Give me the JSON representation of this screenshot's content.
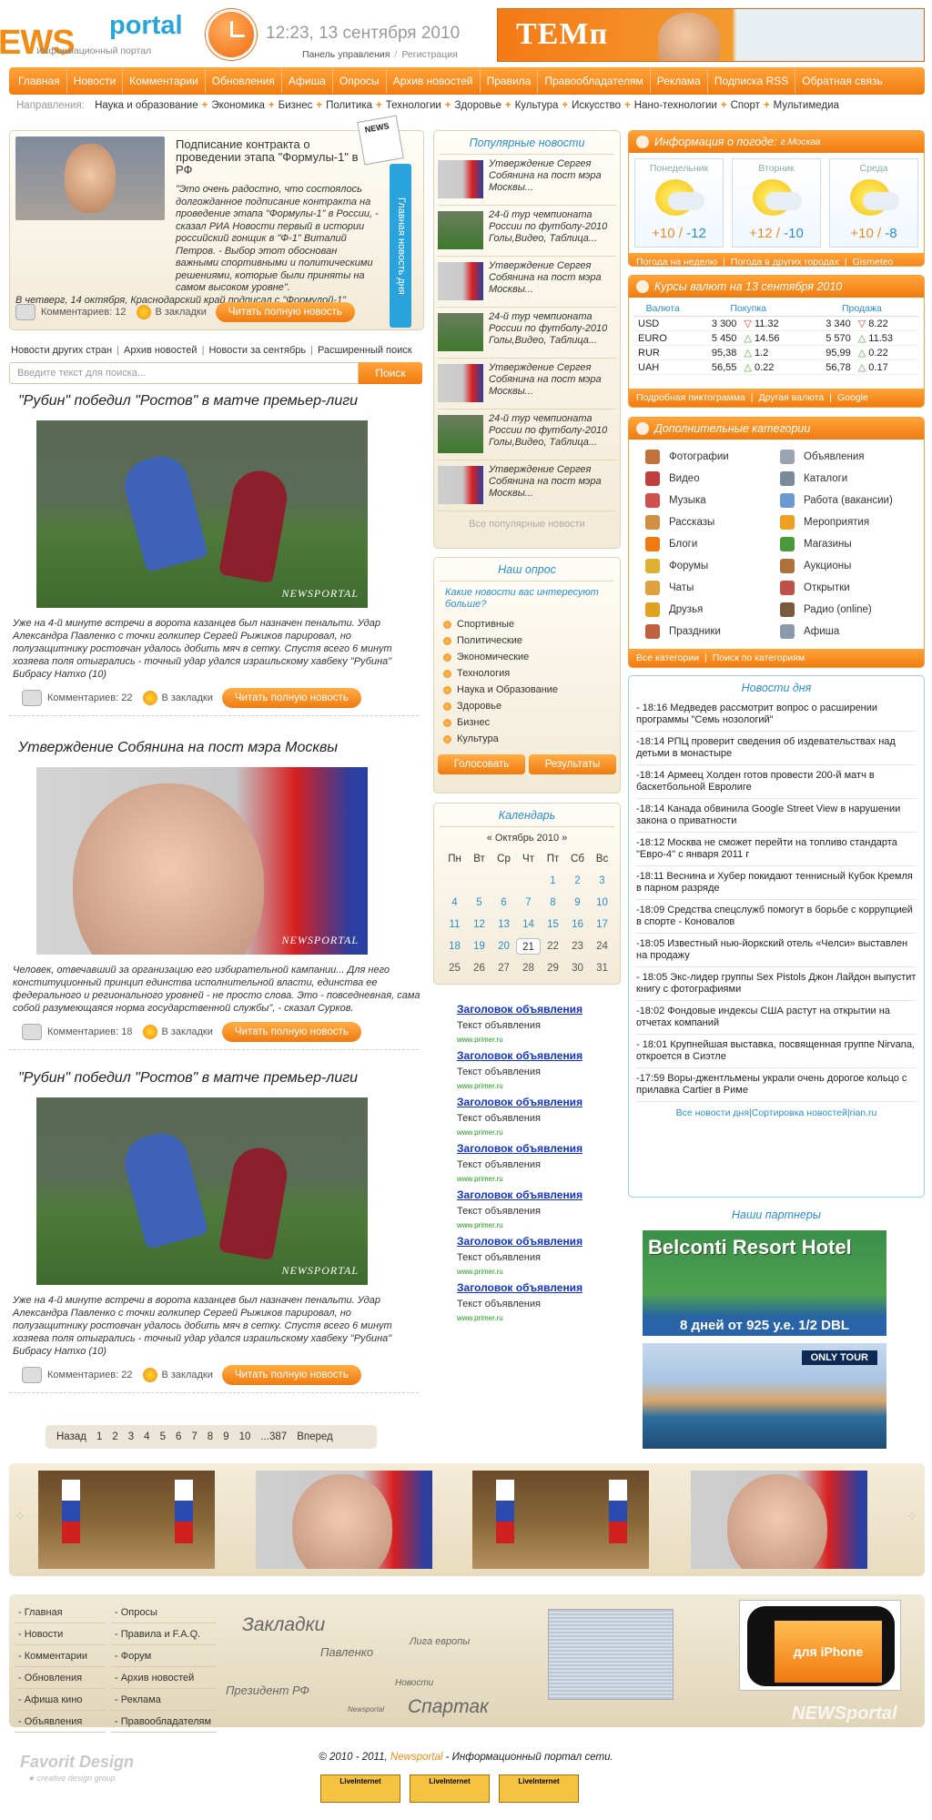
{
  "header": {
    "logo_news": "EWS",
    "logo_portal": "portal",
    "logo_sub": "Информационный портал",
    "datetime": "12:23, 13 сентября 2010",
    "panel_link": "Панель управления",
    "register_link": "Регистрация",
    "banner_text": "ТЕМп"
  },
  "nav": [
    "Главная",
    "Новости",
    "Комментарии",
    "Обновления",
    "Афиша",
    "Опросы",
    "Архив новостей",
    "Правила",
    "Правообладателям",
    "Реклама",
    "Подписка RSS",
    "Обратная связь"
  ],
  "directions": {
    "label": "Направления:",
    "items": [
      "Наука и образование",
      "Экономика",
      "Бизнес",
      "Политика",
      "Технологии",
      "Здоровье",
      "Культура",
      "Искусство",
      "Нано-технологии",
      "Спорт",
      "Мультимедиа"
    ]
  },
  "top_story": {
    "title": "Подписание контракта о проведении этапа \"Формулы-1\" в РФ",
    "paragraph1": "\"Это очень радостно, что состоялось долгожданное подписание контракта на проведение этапа \"Формулы-1\" в России, - сказал РИА Новости первый в истории российский гонщик в \"Ф-1\" Виталий Петров. - Выбор этот обоснован важными спортивными и политическими решениями, которые были приняты на самом высоком уровне\".",
    "paragraph2": "В четверг, 14 октября, Краснодарский край подписал с \"Формулой-1\"",
    "comments": "Комментариев: 12",
    "bookmark": "В закладки",
    "read": "Читать полную новость",
    "tag": "Главная новость дня",
    "paper": "NEWS"
  },
  "subnav": [
    "Новости других стран",
    "Архив новостей",
    "Новости за сентябрь",
    "Расширенный поиск"
  ],
  "search": {
    "placeholder": "Введите текст для поиска...",
    "button": "Поиск"
  },
  "articles": [
    {
      "title": "\"Рубин\" победил \"Ростов\" в матче премьер-лиги",
      "watermark": "NEWSPORTAL",
      "text": "Уже на 4-й минуте встречи в ворота казанцев был назначен пенальти. Удар Александра Павленко с точки голкипер Сергей Рыжиков парировал, но полузащитнику ростовчан удалось добить мяч в сетку. Спустя всего 6 минут хозяева поля отыгрались - точный удар удался израильскому хавбеку \"Рубина\" Бибрасу Натхо (10)",
      "comments": "Комментариев: 22",
      "bookmark": "В закладки",
      "read": "Читать полную новость"
    },
    {
      "title": "Утверждение Собянина на пост мэра Москвы",
      "watermark": "NEWSPORTAL",
      "text": "Человек, отвечавший за организацию его избирательной кампании... Для него конституционный принцип единства исполнительной власти, единства ее федерального и регионального уровней - не просто слова. Это - повседневная, сама собой разумеющаяся норма государственной службы\", - сказал Сурков.",
      "comments": "Комментариев: 18",
      "bookmark": "В закладки",
      "read": "Читать полную новость"
    },
    {
      "title": "\"Рубин\" победил \"Ростов\" в матче премьер-лиги",
      "watermark": "NEWSPORTAL",
      "text": "Уже на 4-й минуте встречи в ворота казанцев был назначен пенальти. Удар Александра Павленко с точки голкипер Сергей Рыжиков парировал, но полузащитнику ростовчан удалось добить мяч в сетку. Спустя всего 6 минут хозяева поля отыгрались - точный удар удался израильскому хавбеку \"Рубина\" Бибрасу Натхо (10)",
      "comments": "Комментариев: 22",
      "bookmark": "В закладки",
      "read": "Читать полную новость"
    }
  ],
  "pager": [
    "Назад",
    "1",
    "2",
    "3",
    "4",
    "5",
    "6",
    "7",
    "8",
    "9",
    "10",
    "...387",
    "Вперед"
  ],
  "popular": {
    "title": "Популярные новости",
    "items": [
      "Утверждение Сергея Собянина на пост мэра Москвы...",
      "24-й тур чемпионата России по футболу-2010 Голы,Видео, Таблица...",
      "Утверждение Сергея Собянина на пост мэра Москвы...",
      "24-й тур чемпионата России по футболу-2010 Голы,Видео, Таблица...",
      "Утверждение Сергея Собянина на пост мэра Москвы...",
      "24-й тур чемпионата России по футболу-2010 Голы,Видео, Таблица...",
      "Утверждение Сергея Собянина на пост мэра Москвы..."
    ],
    "all": "Все популярные новости"
  },
  "poll": {
    "title": "Наш опрос",
    "question": "Какие новости вас интересуют больше?",
    "options": [
      "Спортивные",
      "Политические",
      "Экономические",
      "Технология",
      "Наука и Образование",
      "Здоровье",
      "Бизнес",
      "Культура"
    ],
    "vote": "Голосовать",
    "results": "Результаты"
  },
  "calendar": {
    "title": "Календарь",
    "month": "«   Октябрь 2010   »",
    "days": [
      "Пн",
      "Вт",
      "Ср",
      "Чт",
      "Пт",
      "Сб",
      "Вс"
    ],
    "dates": [
      "1",
      "2",
      "3",
      "4",
      "5",
      "6",
      "7",
      "8",
      "9",
      "10",
      "11",
      "12",
      "13",
      "14",
      "15",
      "16",
      "17",
      "18",
      "19",
      "20",
      "21",
      "22",
      "23",
      "24",
      "25",
      "26",
      "27",
      "28",
      "29",
      "30",
      "31"
    ],
    "today": "21"
  },
  "ads": {
    "title": "Заголовок объявления",
    "text": "Текст объявления",
    "url": "www.primer.ru"
  },
  "weather": {
    "title": "Информация о погоде:",
    "city": "г.Москва",
    "days": [
      {
        "name": "Понедельник",
        "hi": "+10",
        "lo": "-12"
      },
      {
        "name": "Вторник",
        "hi": "+12",
        "lo": "-10"
      },
      {
        "name": "Среда",
        "hi": "+10",
        "lo": "-8"
      }
    ],
    "links": [
      "Погода на неделю",
      "Погода в других городах",
      "Gismeteo"
    ]
  },
  "currency": {
    "title": "Курсы валют на 13 сентября 2010",
    "headers": [
      "Валюта",
      "Покупка",
      "Продажа"
    ],
    "rows": [
      {
        "cur": "USD",
        "buy": "3 300",
        "bd": "11.32",
        "bdir": "down",
        "sell": "3 340",
        "sd": "8.22",
        "sdir": "down"
      },
      {
        "cur": "EURO",
        "buy": "5 450",
        "bd": "14.56",
        "bdir": "up",
        "sell": "5 570",
        "sd": "11.53",
        "sdir": "up"
      },
      {
        "cur": "RUR",
        "buy": "95,38",
        "bd": "1.2",
        "bdir": "up",
        "sell": "95,99",
        "sd": "0.22",
        "sdir": "up"
      },
      {
        "cur": "UAH",
        "buy": "56,55",
        "bd": "0.22",
        "bdir": "up",
        "sell": "56,78",
        "sd": "0.17",
        "sdir": "up"
      }
    ],
    "links": [
      "Подробная пиктограмма",
      "Другая валюта",
      "Google"
    ]
  },
  "categories": {
    "title": "Дополнительные категории",
    "items": [
      {
        "label": "Фотографии",
        "color": "#c0723a"
      },
      {
        "label": "Объявления",
        "color": "#9aa4b2"
      },
      {
        "label": "Видео",
        "color": "#c04040"
      },
      {
        "label": "Каталоги",
        "color": "#7a8a9a"
      },
      {
        "label": "Музыка",
        "color": "#d05050"
      },
      {
        "label": "Работа (вакансии)",
        "color": "#6a9ad0"
      },
      {
        "label": "Рассказы",
        "color": "#d09040"
      },
      {
        "label": "Мероприятия",
        "color": "#f0a020"
      },
      {
        "label": "Блоги",
        "color": "#f07a10"
      },
      {
        "label": "Магазины",
        "color": "#4a9a3a"
      },
      {
        "label": "Форумы",
        "color": "#e0b030"
      },
      {
        "label": "Аукционы",
        "color": "#b0703a"
      },
      {
        "label": "Чаты",
        "color": "#e0a040"
      },
      {
        "label": "Открытки",
        "color": "#c0504a"
      },
      {
        "label": "Друзья",
        "color": "#e0a020"
      },
      {
        "label": "Радио (online)",
        "color": "#7a5a3a"
      },
      {
        "label": "Праздники",
        "color": "#c06040"
      },
      {
        "label": "Афиша",
        "color": "#8a9aaa"
      }
    ],
    "links": [
      "Все категории",
      "Поиск по категориям"
    ]
  },
  "day_news": {
    "title": "Новости дня",
    "items": [
      "- 18:16 Медведев рассмотрит вопрос о расширении программы \"Семь нозологий\"",
      "-18:14 РПЦ проверит сведения об издевательствах над детьми в монастыре",
      "-18:14 Армеец Холден готов провести 200-й матч в баскетбольной Евролиге",
      "-18:14 Канада обвинила Google Street View в нарушении закона о приватности",
      "-18:12 Москва не сможет перейти на топливо стандарта \"Евро-4\" с января 2011 г",
      "-18:11 Веснина и Хубер покидают теннисный Кубок Кремля в парном разряде",
      "-18:09 Средства спецслужб помогут в борьбе с коррупцией в спорте - Коновалов",
      "-18:05 Известный нью-йоркский отель «Челси» выставлен на продажу",
      "- 18:05 Экс-лидер группы Sex Pistols Джон Лайдон выпустит книгу с фотографиями",
      "-18:02 Фондовые индексы США растут на открытии на отчетах компаний",
      "- 18:01 Крупнейшая выставка, посвященная группе Nirvana, откроется в Сиэтле",
      "-17:59 Воры-джентльмены украли очень дорогое кольцо с прилавка Cartier в Риме"
    ],
    "links": [
      "Все новости дня",
      "Сортировка новостей",
      "rian.ru"
    ]
  },
  "partners": {
    "title": "Наши партнеры",
    "hotel": "Belconti Resort Hotel",
    "hotel_offer": "8 дней от 925 у.е. 1/2 DBL",
    "tour": "ONLY TOUR"
  },
  "footer": {
    "col1": [
      "- Главная",
      "- Новости",
      "- Комментарии",
      "- Обновления",
      "- Афиша кино",
      "- Объявления"
    ],
    "col2": [
      "- Опросы",
      "- Правила и F.A.Q.",
      "- Форум",
      "- Архив новостей",
      "- Реклама",
      "- Правообладателям"
    ],
    "tags": {
      "t1": "Закладки",
      "t2": "Павленко",
      "t3": "Лига европы",
      "t4": "Новости",
      "t5": "Президент РФ",
      "t6": "Newsportal",
      "t7": "Спартак"
    },
    "iphone": "для iPhone",
    "watermark": "NEWSportal",
    "design": "Favorit Design",
    "design_sub": "★ creative design group",
    "copyright_pre": "© 2010 - 2011,",
    "copyright_brand": "Newsportal",
    "copyright_post": "- Информационный портал сети.",
    "counter": "LiveInternet"
  }
}
